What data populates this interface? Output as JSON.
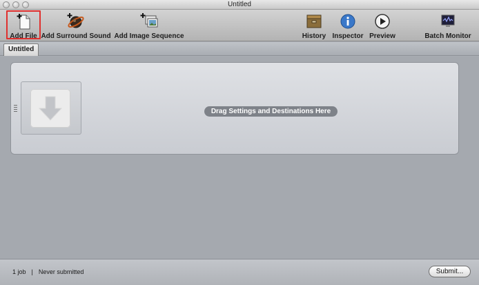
{
  "window": {
    "title": "Untitled"
  },
  "toolbar": {
    "items": [
      {
        "label": "Add File",
        "icon": "add-file-icon"
      },
      {
        "label": "Add Surround Sound",
        "icon": "surround-sound-icon"
      },
      {
        "label": "Add Image Sequence",
        "icon": "image-sequence-icon"
      },
      {
        "label": "History",
        "icon": "history-icon"
      },
      {
        "label": "Inspector",
        "icon": "inspector-icon"
      },
      {
        "label": "Preview",
        "icon": "preview-icon"
      },
      {
        "label": "Batch Monitor",
        "icon": "batch-monitor-icon"
      }
    ]
  },
  "tabs": [
    {
      "label": "Untitled"
    }
  ],
  "job": {
    "drop_hint": "Drag Settings and Destinations Here"
  },
  "status": {
    "job_count": "1 job",
    "submission": "Never submitted"
  },
  "actions": {
    "submit_label": "Submit..."
  },
  "colors": {
    "highlight": "#e0302e",
    "inspector_blue": "#3a78c9"
  }
}
